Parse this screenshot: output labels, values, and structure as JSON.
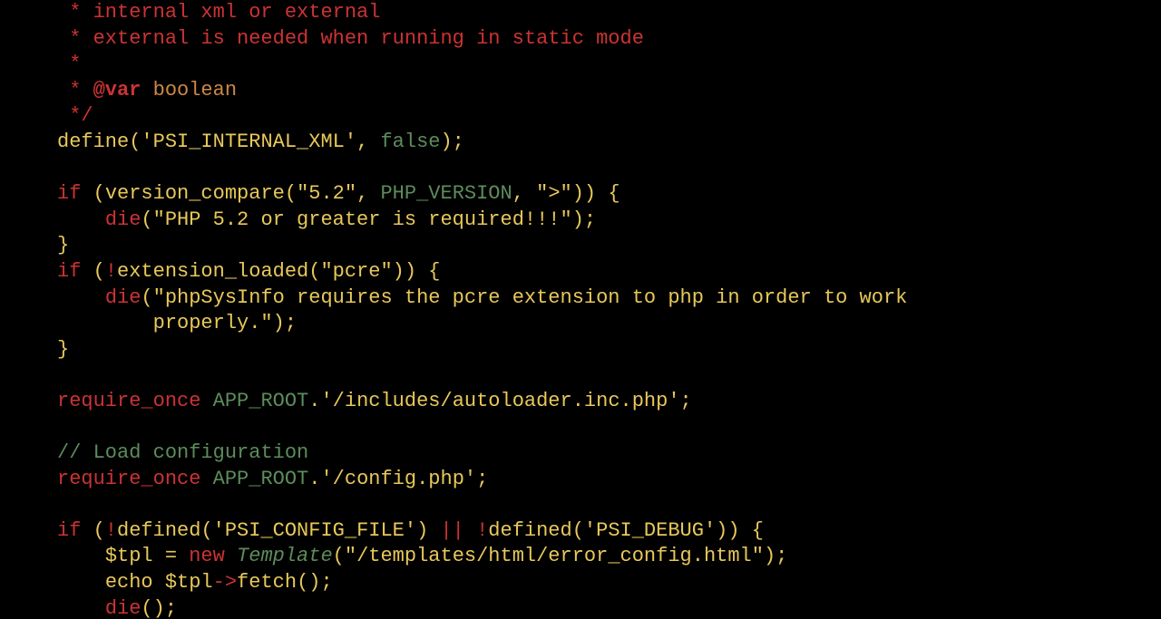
{
  "code": {
    "doc": {
      "line1": " * internal xml or external",
      "line2": " * external is needed when running in static mode",
      "line3": " *",
      "line4_star": " * ",
      "var_tag": "@var",
      "var_type": " boolean",
      "close": " */"
    },
    "define_kw": "define",
    "define_open": "(",
    "define_str": "'PSI_INTERNAL_XML'",
    "define_comma": ", ",
    "define_val": "false",
    "define_close": ");",
    "if1_kw": "if",
    "if1_open": " (",
    "if1_fn": "version_compare",
    "if1_args_open": "(",
    "if1_arg1": "\"5.2\"",
    "if1_comma1": ", ",
    "if1_const": "PHP_VERSION",
    "if1_comma2": ", ",
    "if1_arg3": "\">\"",
    "if1_args_close": ")) {",
    "if1_die": "die",
    "if1_die_open": "(",
    "if1_die_str": "\"PHP 5.2 or greater is required!!!\"",
    "if1_die_close": ");",
    "if1_brace_close": "}",
    "if2_kw": "if",
    "if2_open": " (",
    "if2_not": "!",
    "if2_fn": "extension_loaded",
    "if2_args_open": "(",
    "if2_arg": "\"pcre\"",
    "if2_args_close": ")) {",
    "if2_die": "die",
    "if2_die_open": "(",
    "if2_die_str1": "\"phpSysInfo requires the pcre extension to php in order to work",
    "if2_die_str2": "        properly.\"",
    "if2_die_close": ");",
    "if2_brace_close": "}",
    "req1_kw": "require_once",
    "req1_sp": " ",
    "req1_const": "APP_ROOT",
    "req1_dot": ".",
    "req1_str": "'/includes/autoloader.inc.php'",
    "req1_semi": ";",
    "loadcfg_comment": "// Load configuration",
    "req2_kw": "require_once",
    "req2_sp": " ",
    "req2_const": "APP_ROOT",
    "req2_dot": ".",
    "req2_str": "'/config.php'",
    "req2_semi": ";",
    "if3_kw": "if",
    "if3_open": " (",
    "if3_not1": "!",
    "if3_def1": "defined",
    "if3_po1": "(",
    "if3_s1": "'PSI_CONFIG_FILE'",
    "if3_pc1": ") ",
    "if3_or": "||",
    "if3_sp": " ",
    "if3_not2": "!",
    "if3_def2": "defined",
    "if3_po2": "(",
    "if3_s2": "'PSI_DEBUG'",
    "if3_pc2": ")) {",
    "if3_tpl_var": "$tpl",
    "if3_eq": " = ",
    "if3_new": "new",
    "if3_sp2": " ",
    "if3_class": "Template",
    "if3_cpo": "(",
    "if3_cstr": "\"/templates/html/error_config.html\"",
    "if3_cpc": ");",
    "if3_echo": "echo ",
    "if3_tpl_var2": "$tpl",
    "if3_arrow": "->",
    "if3_fetch": "fetch",
    "if3_fetch_pc": "();",
    "if3_die": "die",
    "if3_die_pc": "();"
  }
}
